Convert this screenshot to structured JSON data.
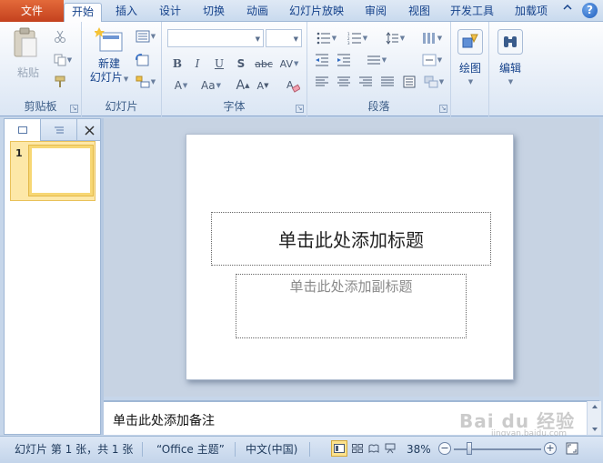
{
  "tabs": {
    "file": "文件",
    "home": "开始",
    "insert": "插入",
    "design": "设计",
    "transitions": "切换",
    "animations": "动画",
    "slideshow": "幻灯片放映",
    "review": "审阅",
    "view": "视图",
    "developer": "开发工具",
    "addins": "加载项",
    "help": "?"
  },
  "ribbon": {
    "clipboard": {
      "label": "剪贴板",
      "paste": "粘贴"
    },
    "slides": {
      "label": "幻灯片",
      "new_slide_line1": "新建",
      "new_slide_line2": "幻灯片"
    },
    "font": {
      "label": "字体",
      "bold": "B",
      "italic": "I",
      "underline": "U",
      "shadow": "S",
      "strike": "abc",
      "spacing": "AV",
      "font_color": "A",
      "change_case": "Aa",
      "grow": "A",
      "shrink": "A"
    },
    "paragraph": {
      "label": "段落"
    },
    "drawing": {
      "label": "绘图"
    },
    "editing": {
      "label": "编辑"
    }
  },
  "left_panel": {
    "slide_number": "1"
  },
  "slide": {
    "title_placeholder": "单击此处添加标题",
    "subtitle_placeholder": "单击此处添加副标题"
  },
  "notes": {
    "placeholder": "单击此处添加备注"
  },
  "status": {
    "slide_info": "幻灯片 第 1 张，共 1 张",
    "theme": "“Office 主题”",
    "language": "中文(中国)",
    "zoom": "38%"
  },
  "watermark": {
    "text": "Bai du 经验",
    "url": "jingyan.baidu.com"
  },
  "colors": {
    "file_tab": "#d2522b",
    "ribbon_bg": "#e8eff8",
    "accent": "#15428b"
  }
}
